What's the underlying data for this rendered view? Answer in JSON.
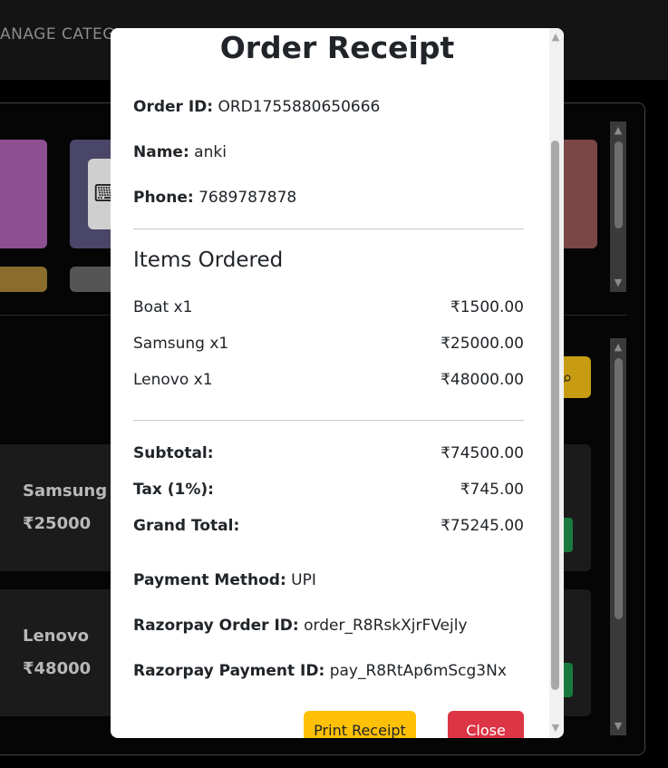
{
  "background": {
    "nav_text": "ANAGE CATEG",
    "products": [
      {
        "name": "Samsung",
        "price": "₹25000"
      },
      {
        "name": "Lenovo",
        "price": "₹48000"
      }
    ],
    "icons": {
      "keyboard": "keyboard-icon",
      "search": "search-icon"
    },
    "colors": {
      "search_button": "#c79c12",
      "action_button": "#1a7a3e"
    }
  },
  "receipt": {
    "title": "Order Receipt",
    "order_id_label": "Order ID:",
    "order_id": "ORD1755880650666",
    "name_label": "Name:",
    "name": "anki",
    "phone_label": "Phone:",
    "phone": "7689787878",
    "items_heading": "Items Ordered",
    "items": [
      {
        "label": "Boat x1",
        "amount": "₹1500.00"
      },
      {
        "label": "Samsung x1",
        "amount": "₹25000.00"
      },
      {
        "label": "Lenovo x1",
        "amount": "₹48000.00"
      }
    ],
    "subtotal_label": "Subtotal:",
    "subtotal": "₹74500.00",
    "tax_label": "Tax (1%):",
    "tax": "₹745.00",
    "grand_total_label": "Grand Total:",
    "grand_total": "₹75245.00",
    "payment_method_label": "Payment Method:",
    "payment_method": "UPI",
    "razorpay_order_label": "Razorpay Order ID:",
    "razorpay_order_id": "order_R8RskXjrFVejly",
    "razorpay_payment_label": "Razorpay Payment ID:",
    "razorpay_payment_id": "pay_R8RtAp6mScg3Nx",
    "print_button": "Print Receipt",
    "close_button": "Close",
    "colors": {
      "print": "#ffc107",
      "close": "#dc3545"
    }
  }
}
